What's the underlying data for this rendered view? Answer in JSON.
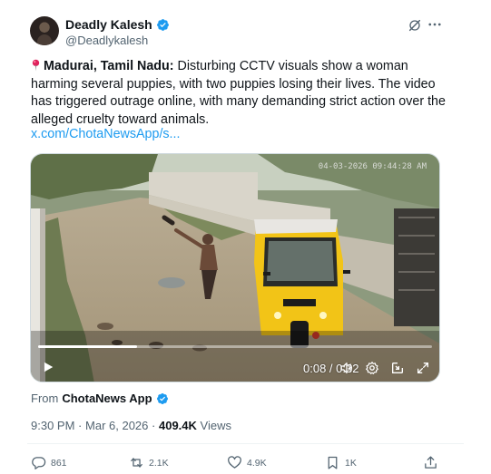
{
  "author": {
    "display_name": "Deadly Kalesh",
    "handle": "@Deadlykalesh"
  },
  "tweet": {
    "location_bold": "Madurai, Tamil Nadu:",
    "text": " Disturbing CCTV visuals show a woman harming several puppies, with two puppies losing their lives. The video has triggered outrage online, with many demanding strict action over the alleged cruelty toward animals.",
    "link": "x.com/ChotaNewsApp/s..."
  },
  "video": {
    "overlay_timestamp": "04-03-2026 09:44:28 AM",
    "current_time": "0:08",
    "duration": "0:32",
    "progress_fraction": 0.25
  },
  "source": {
    "prefix": "From",
    "name": "ChotaNews App"
  },
  "meta": {
    "time": "9:30 PM",
    "separator": "·",
    "date": "Mar 6, 2026",
    "views": "409.4K",
    "views_label": "Views"
  },
  "actions": {
    "replies": "861",
    "reposts": "2.1K",
    "likes": "4.9K",
    "bookmarks": "1K"
  },
  "colors": {
    "accent": "#1d9bf0",
    "muted": "#536471",
    "text": "#0f1419",
    "verified": "#1d9bf0",
    "pin": "#e0245e",
    "rickshaw": "#f2c417"
  },
  "icons": [
    "verified-badge-icon",
    "grok-icon",
    "more-icon",
    "pin-icon",
    "play-icon",
    "volume-icon",
    "settings-icon",
    "pip-icon",
    "fullscreen-icon",
    "reply-icon",
    "repost-icon",
    "like-icon",
    "bookmark-icon",
    "share-icon"
  ]
}
